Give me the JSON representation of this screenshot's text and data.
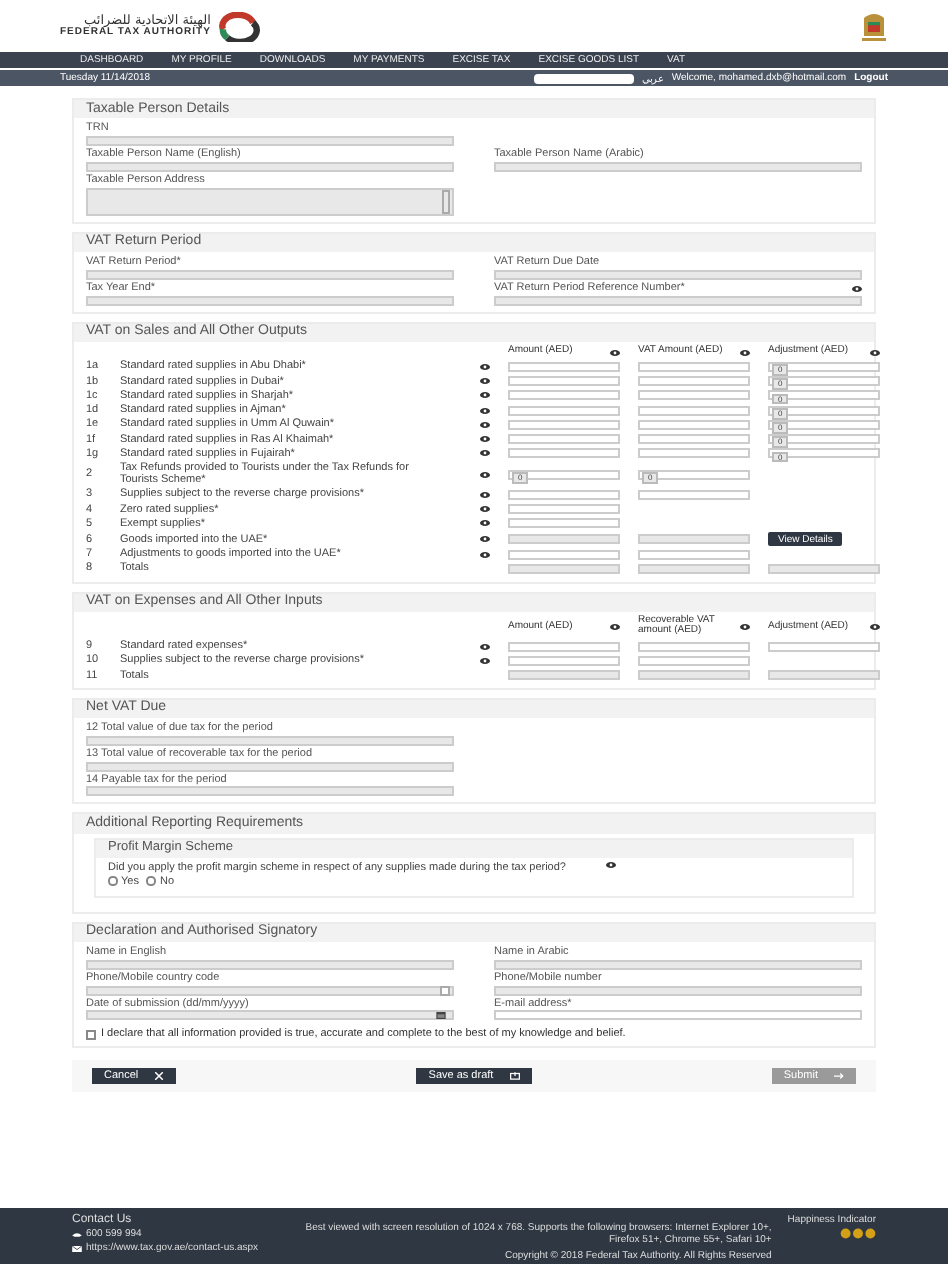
{
  "header": {
    "logo_arabic": "الهيئة الاتحادية للضرائب",
    "logo_english": "FEDERAL TAX AUTHORITY"
  },
  "nav": [
    "DASHBOARD",
    "MY PROFILE",
    "DOWNLOADS",
    "MY PAYMENTS",
    "EXCISE TAX",
    "EXCISE GOODS LIST",
    "VAT"
  ],
  "subbar": {
    "date": "Tuesday 11/14/2018",
    "language": "عربي",
    "welcome": "Welcome, mohamed.dxb@hotmail.com",
    "logout": "Logout"
  },
  "taxable_person": {
    "title": "Taxable Person Details",
    "fields": [
      {
        "label": "TRN",
        "kind": "text",
        "info": false
      },
      {
        "label": "Taxable Person Name (English)",
        "kind": "text",
        "info": false
      },
      {
        "label": "Taxable Person Name (Arabic)",
        "kind": "text",
        "info": false
      },
      {
        "label": "Taxable Person Address",
        "kind": "textarea",
        "info": false
      }
    ]
  },
  "return_period": {
    "title": "VAT Return Period",
    "fields": [
      {
        "label": "VAT Return Period*",
        "kind": "text",
        "info": false
      },
      {
        "label": "VAT Return Due Date",
        "kind": "text",
        "info": false
      },
      {
        "label": "Tax Year End*",
        "kind": "text",
        "info": false
      },
      {
        "label": "VAT Return Period Reference Number*",
        "kind": "text",
        "info": true
      }
    ]
  },
  "sales": {
    "title": "VAT on Sales and All Other Outputs",
    "columns": [
      "Amount (AED)",
      "VAT Amount (AED)",
      "Adjustment (AED)"
    ],
    "rows": [
      {
        "num": "1a",
        "label": "Standard rated supplies in Abu Dhabi*",
        "info": true,
        "cells": [
          {
            "kind": "input"
          },
          {
            "kind": "input"
          },
          {
            "kind": "zero",
            "value": "0"
          }
        ]
      },
      {
        "num": "1b",
        "label": "Standard rated supplies in Dubai*",
        "info": true,
        "cells": [
          {
            "kind": "input"
          },
          {
            "kind": "input"
          },
          {
            "kind": "zero",
            "value": "0"
          }
        ]
      },
      {
        "num": "1c",
        "label": "Standard rated supplies in Sharjah*",
        "info": true,
        "cells": [
          {
            "kind": "input"
          },
          {
            "kind": "input"
          },
          {
            "kind": "zero",
            "value": "0"
          }
        ]
      },
      {
        "num": "1d",
        "label": "Standard rated supplies in Ajman*",
        "info": true,
        "cells": [
          {
            "kind": "input"
          },
          {
            "kind": "input"
          },
          {
            "kind": "zero",
            "value": "0"
          }
        ]
      },
      {
        "num": "1e",
        "label": "Standard rated supplies in Umm Al Quwain*",
        "info": true,
        "cells": [
          {
            "kind": "input"
          },
          {
            "kind": "input"
          },
          {
            "kind": "zero",
            "value": "0"
          }
        ]
      },
      {
        "num": "1f",
        "label": "Standard rated supplies in Ras Al Khaimah*",
        "info": true,
        "cells": [
          {
            "kind": "input"
          },
          {
            "kind": "input"
          },
          {
            "kind": "zero",
            "value": "0"
          }
        ]
      },
      {
        "num": "1g",
        "label": "Standard rated supplies in Fujairah*",
        "info": true,
        "cells": [
          {
            "kind": "input"
          },
          {
            "kind": "input"
          },
          {
            "kind": "zero",
            "value": "0"
          }
        ]
      },
      {
        "num": "2",
        "label": "Tax Refunds provided to Tourists under the Tax Refunds for Tourists Scheme*",
        "info": true,
        "cells": [
          {
            "kind": "zero",
            "value": "0"
          },
          {
            "kind": "zero",
            "value": "0"
          }
        ]
      },
      {
        "num": "3",
        "label": "Supplies subject to the reverse charge provisions*",
        "info": true,
        "cells": [
          {
            "kind": "input"
          },
          {
            "kind": "input"
          }
        ]
      },
      {
        "num": "4",
        "label": "Zero rated supplies*",
        "info": true,
        "cells": [
          {
            "kind": "input"
          }
        ]
      },
      {
        "num": "5",
        "label": "Exempt supplies*",
        "info": true,
        "cells": [
          {
            "kind": "input"
          }
        ]
      },
      {
        "num": "6",
        "label": "Goods imported into the UAE*",
        "info": true,
        "cells": [
          {
            "kind": "readonly"
          },
          {
            "kind": "readonly"
          },
          {
            "kind": "button",
            "label": "View Details"
          }
        ]
      },
      {
        "num": "7",
        "label": "Adjustments to goods imported into the UAE*",
        "info": true,
        "cells": [
          {
            "kind": "input"
          },
          {
            "kind": "input"
          }
        ]
      },
      {
        "num": "8",
        "label": "Totals",
        "info": false,
        "cells": [
          {
            "kind": "readonly"
          },
          {
            "kind": "readonly"
          },
          {
            "kind": "readonly"
          }
        ]
      }
    ]
  },
  "expenses": {
    "title": "VAT on Expenses and All Other Inputs",
    "columns": [
      "Amount (AED)",
      "Recoverable VAT amount (AED)",
      "Adjustment (AED)"
    ],
    "rows": [
      {
        "num": "9",
        "label": "Standard rated expenses*",
        "info": true,
        "cells": [
          {
            "kind": "input"
          },
          {
            "kind": "input"
          },
          {
            "kind": "input"
          }
        ]
      },
      {
        "num": "10",
        "label": "Supplies subject to the reverse charge provisions*",
        "info": true,
        "cells": [
          {
            "kind": "input"
          },
          {
            "kind": "input"
          }
        ]
      },
      {
        "num": "11",
        "label": "Totals",
        "info": false,
        "cells": [
          {
            "kind": "readonly"
          },
          {
            "kind": "readonly"
          },
          {
            "kind": "readonly"
          }
        ]
      }
    ]
  },
  "net_vat": {
    "title": "Net VAT Due",
    "fields": [
      {
        "label": "12  Total value of due tax for the period",
        "kind": "text",
        "info": false
      },
      {
        "label": "13  Total value of recoverable tax for the period",
        "kind": "text",
        "info": false
      },
      {
        "label": "14  Payable tax for the period",
        "kind": "text",
        "info": false
      }
    ]
  },
  "additional": {
    "title": "Additional Reporting Requirements",
    "subtitle": "Profit Margin Scheme",
    "question": "Did you apply the profit margin scheme in respect of any supplies made during the tax period?",
    "options": [
      {
        "label": "Yes",
        "selected": false
      },
      {
        "label": "No",
        "selected": false
      }
    ]
  },
  "declaration": {
    "title": "Declaration and Authorised Signatory",
    "fields": [
      {
        "label": "Name in English",
        "kind": "text",
        "info": false
      },
      {
        "label": "Name in Arabic",
        "kind": "text",
        "info": false
      },
      {
        "label": "Phone/Mobile country code",
        "kind": "select",
        "info": false
      },
      {
        "label": "Phone/Mobile number",
        "kind": "text",
        "info": false
      },
      {
        "label": "Date of submission (dd/mm/yyyy)",
        "kind": "date",
        "info": false
      },
      {
        "label": "E-mail address*",
        "kind": "input",
        "info": false
      }
    ],
    "statement": "I declare that all information provided is true, accurate and complete to the best of my knowledge and belief.",
    "checked": false
  },
  "actions": [
    {
      "label": "Cancel",
      "kind": "cancel",
      "disabled": false
    },
    {
      "label": "Save as draft",
      "kind": "draft",
      "disabled": false
    },
    {
      "label": "Submit",
      "kind": "submit",
      "disabled": true
    }
  ],
  "footer": {
    "contact_title": "Contact Us",
    "phone": "600 599 994",
    "link": "https://www.tax.gov.ae/contact-us.aspx",
    "notice": "Best viewed with screen resolution of 1024 x 768. Supports the following browsers: Internet Explorer 10+, Firefox 51+, Chrome 55+, Safari 10+",
    "copyright": "Copyright © 2018 Federal Tax Authority. All Rights Reserved",
    "happiness": "Happiness Indicator"
  }
}
